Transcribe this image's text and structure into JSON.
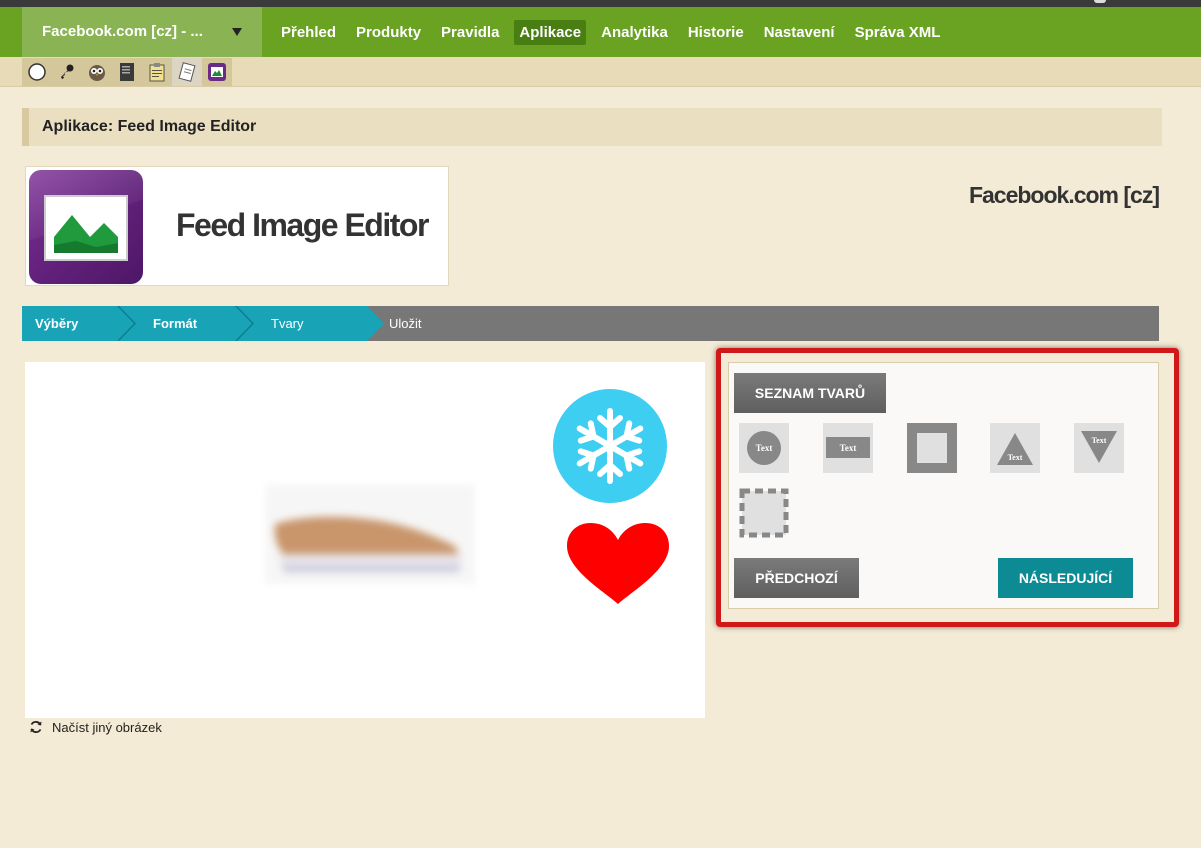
{
  "nav": {
    "project": "Facebook.com [cz] - ...",
    "items": [
      "Přehled",
      "Produkty",
      "Pravidla",
      "Aplikace",
      "Analytika",
      "Historie",
      "Nastavení",
      "Správa XML"
    ],
    "active": "Aplikace"
  },
  "toolbar": {
    "icons": [
      "moon-icon",
      "key-icon",
      "owl-icon",
      "book-icon",
      "clipboard-icon",
      "document-icon",
      "image-editor-icon"
    ]
  },
  "page": {
    "title": "Aplikace: Feed Image Editor",
    "app_name": "Feed Image Editor",
    "site_name": "Facebook.com [cz]"
  },
  "steps": [
    "Výběry",
    "Formát",
    "Tvary",
    "Uložit"
  ],
  "canvas": {
    "reload_label": "Načíst jiný obrázek"
  },
  "panel": {
    "list_button": "SEZNAM TVARŮ",
    "shape_text": "Text",
    "prev_button": "PŘEDCHOZÍ",
    "next_button": "NÁSLEDUJÍCÍ"
  },
  "colors": {
    "nav_green": "#6aa222",
    "nav_active": "#497f12",
    "step_teal": "#19a3b6",
    "next_teal": "#0c8b94",
    "highlight_red": "#d01818"
  }
}
